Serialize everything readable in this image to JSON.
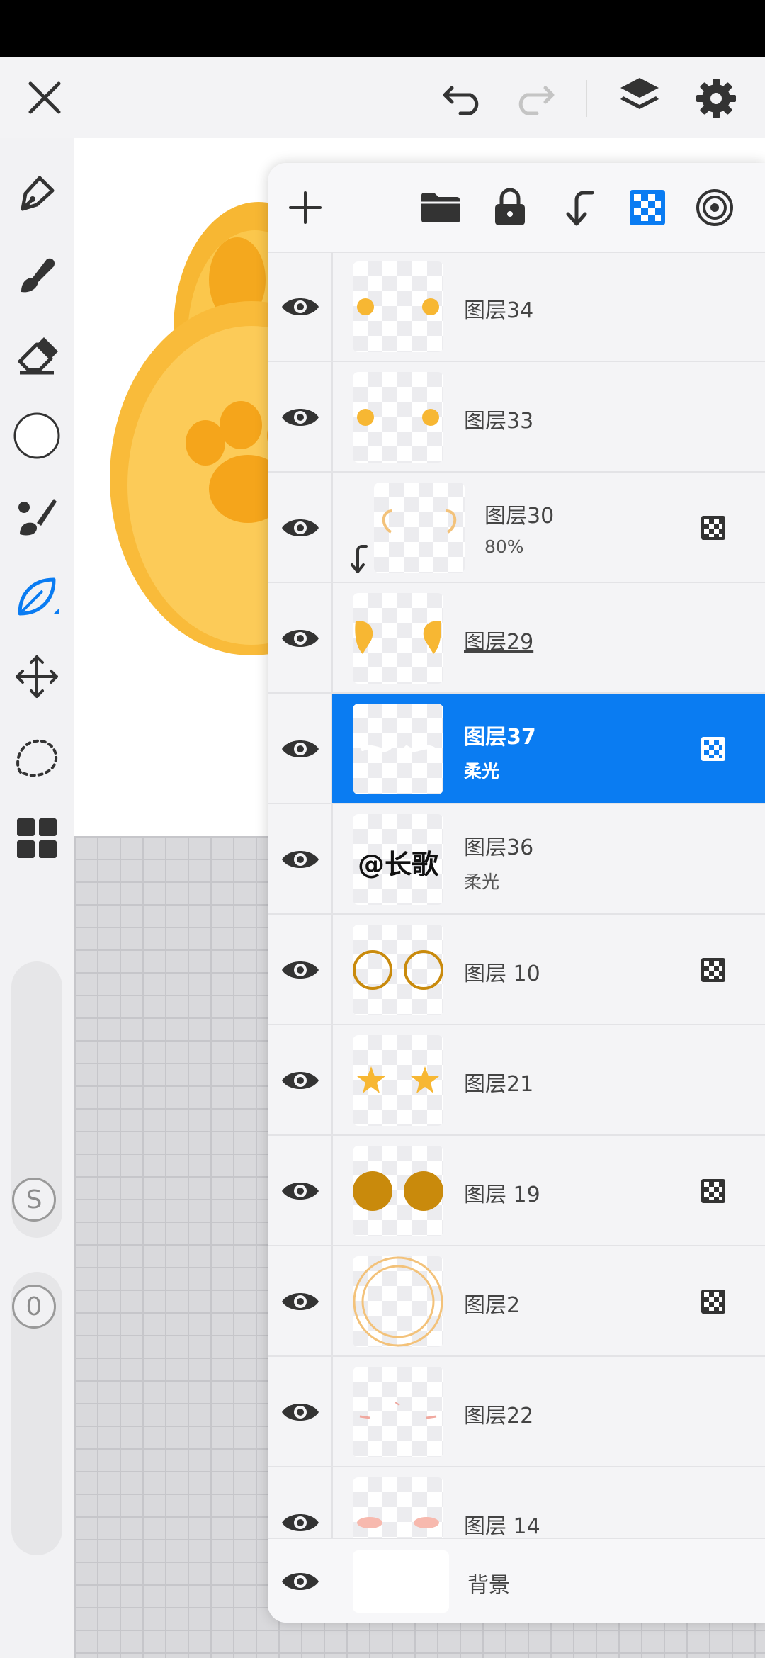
{
  "toolbar": {
    "icons": [
      "close-icon",
      "undo-icon",
      "redo-icon",
      "layers-icon",
      "gear-icon"
    ]
  },
  "left_tools": [
    "pen-icon",
    "brush-icon",
    "eraser-icon",
    "color-icon",
    "smudge-icon",
    "leaf-icon",
    "move-icon",
    "lasso-icon",
    "grid-icon"
  ],
  "sliders": {
    "size_badge": "S",
    "opacity_badge": "0"
  },
  "layer_panel": {
    "head_icons": [
      "add-icon",
      "folder-icon",
      "lock-icon",
      "clip-down-icon",
      "alpha-lock-icon",
      "target-icon"
    ],
    "accent": "#0a7cf2",
    "layers": [
      {
        "name": "图层34",
        "sub": "",
        "checker": false,
        "selected": false,
        "clip": false
      },
      {
        "name": "图层33",
        "sub": "",
        "checker": false,
        "selected": false,
        "clip": false
      },
      {
        "name": "图层30",
        "sub": "80%",
        "checker": true,
        "selected": false,
        "clip": true
      },
      {
        "name": "图层29",
        "sub": "",
        "checker": false,
        "selected": false,
        "clip": false
      },
      {
        "name": "图层37",
        "sub": "柔光",
        "checker": true,
        "selected": true,
        "clip": false
      },
      {
        "name": "图层36",
        "sub": "柔光",
        "checker": false,
        "selected": false,
        "clip": false
      },
      {
        "name": "图层 10",
        "sub": "",
        "checker": true,
        "selected": false,
        "clip": false
      },
      {
        "name": "图层21",
        "sub": "",
        "checker": false,
        "selected": false,
        "clip": false
      },
      {
        "name": "图层 19",
        "sub": "",
        "checker": true,
        "selected": false,
        "clip": false
      },
      {
        "name": "图层2",
        "sub": "",
        "checker": true,
        "selected": false,
        "clip": false
      },
      {
        "name": "图层22",
        "sub": "",
        "checker": false,
        "selected": false,
        "clip": false
      },
      {
        "name": "图层 14",
        "sub": "",
        "checker": false,
        "selected": false,
        "clip": false
      }
    ],
    "thumb36_text": "@长歌",
    "background_label": "背景"
  }
}
